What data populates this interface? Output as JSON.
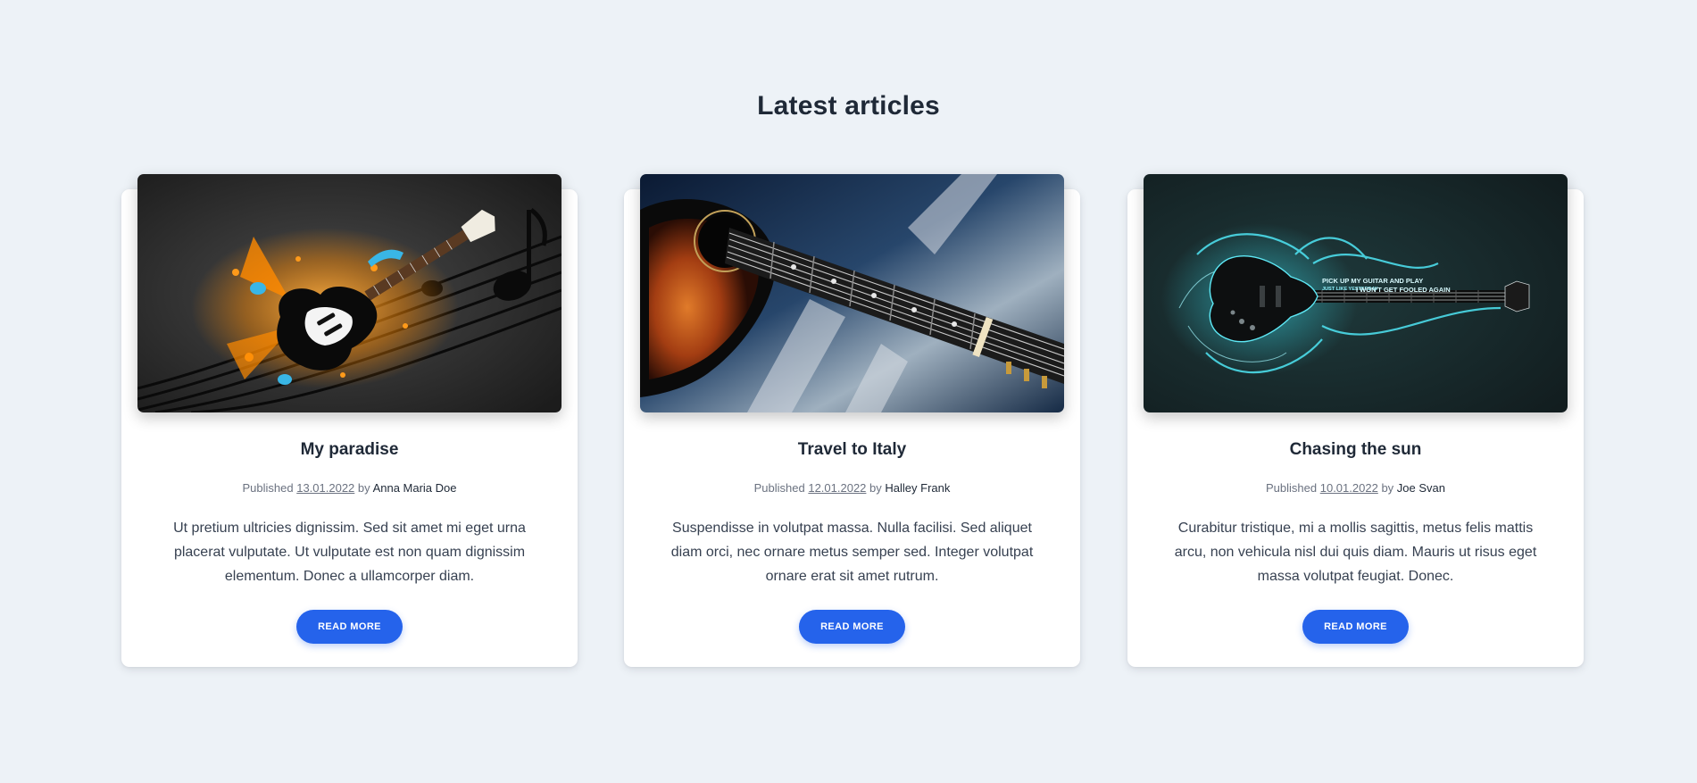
{
  "section": {
    "title": "Latest articles"
  },
  "colors": {
    "page_background": "#edf2f7",
    "card_background": "#ffffff",
    "accent": "#2563eb",
    "heading_text": "#1f2937",
    "muted_text": "#6b7280"
  },
  "articles": [
    {
      "title": "My paradise",
      "published_label": "Published",
      "date": "13.01.2022",
      "by_label": "by",
      "author": "Anna Maria Doe",
      "excerpt": "Ut pretium ultricies dignissim. Sed sit amet mi eget urna placerat vulputate. Ut vulputate est non quam dignissim elementum. Donec a ullamcorper diam.",
      "button_label": "READ MORE",
      "image_icon": "electric-guitar-music-notes-image"
    },
    {
      "title": "Travel to Italy",
      "published_label": "Published",
      "date": "12.01.2022",
      "by_label": "by",
      "author": "Halley Frank",
      "excerpt": "Suspendisse in volutpat massa. Nulla facilisi. Sed aliquet diam orci, nec ornare metus semper sed. Integer volutpat ornare erat sit amet rutrum.",
      "button_label": "READ MORE",
      "image_icon": "acoustic-guitar-closeup-image"
    },
    {
      "title": "Chasing the sun",
      "published_label": "Published",
      "date": "10.01.2022",
      "by_label": "by",
      "author": "Joe Svan",
      "excerpt": "Curabitur tristique, mi a mollis sagittis, metus felis mattis arcu, non vehicula nisl dui quis diam. Mauris ut risus eget massa volutpat feugiat. Donec.",
      "button_label": "READ MORE",
      "image_icon": "neon-electric-guitar-image",
      "image_text": [
        "PICK UP MY GUITAR AND PLAY",
        "JUST LIKE YESTERDAY",
        "I WON'T GET FOOLED AGAIN"
      ]
    }
  ]
}
